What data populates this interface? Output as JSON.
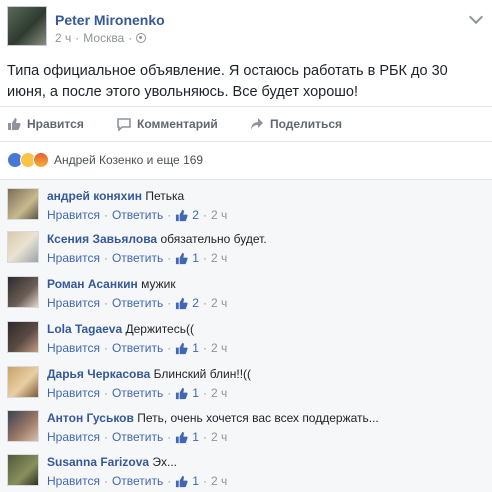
{
  "post": {
    "author": "Peter Mironenko",
    "time": "2 ч",
    "location": "Москва",
    "text": "Типа официальное объявление. Я остаюсь работать в РБК до 30 июня, а после этого увольняюсь. Все будет хорошо!"
  },
  "actions": {
    "like": "Нравится",
    "comment": "Комментарий",
    "share": "Поделиться"
  },
  "reactions": {
    "summary": "Андрей Козенко и еще 169"
  },
  "comment_labels": {
    "like": "Нравится",
    "reply": "Ответить",
    "sep": "·"
  },
  "comments": [
    {
      "author": "андрей коняхин",
      "text": "Петька",
      "likes": "2",
      "time": "2 ч"
    },
    {
      "author": "Ксения Завьялова",
      "text": "обязательно будет.",
      "likes": "1",
      "time": "2 ч"
    },
    {
      "author": "Роман Асанкин",
      "text": "мужик",
      "likes": "2",
      "time": "2 ч"
    },
    {
      "author": "Lola Tagaeva",
      "text": "Держитесь((",
      "likes": "1",
      "time": "2 ч"
    },
    {
      "author": "Дарья Черкасова",
      "text": "Блинский блин!!((",
      "likes": "1",
      "time": "2 ч"
    },
    {
      "author": "Антон Гуськов",
      "text": "Петь, очень хочется вас всех поддержать...",
      "likes": "1",
      "time": "2 ч"
    },
    {
      "author": "Susanna Farizova",
      "text": "Эх...",
      "likes": "1",
      "time": "2 ч"
    }
  ],
  "colors": {
    "link": "#365899",
    "meta": "#90949c",
    "action": "#4267b2"
  },
  "icons": [
    "globe-icon",
    "chevron-down-icon",
    "like-icon",
    "comment-icon",
    "share-icon",
    "like-reaction-icon",
    "sad-reaction-icon",
    "angry-reaction-icon",
    "mini-like-icon"
  ]
}
